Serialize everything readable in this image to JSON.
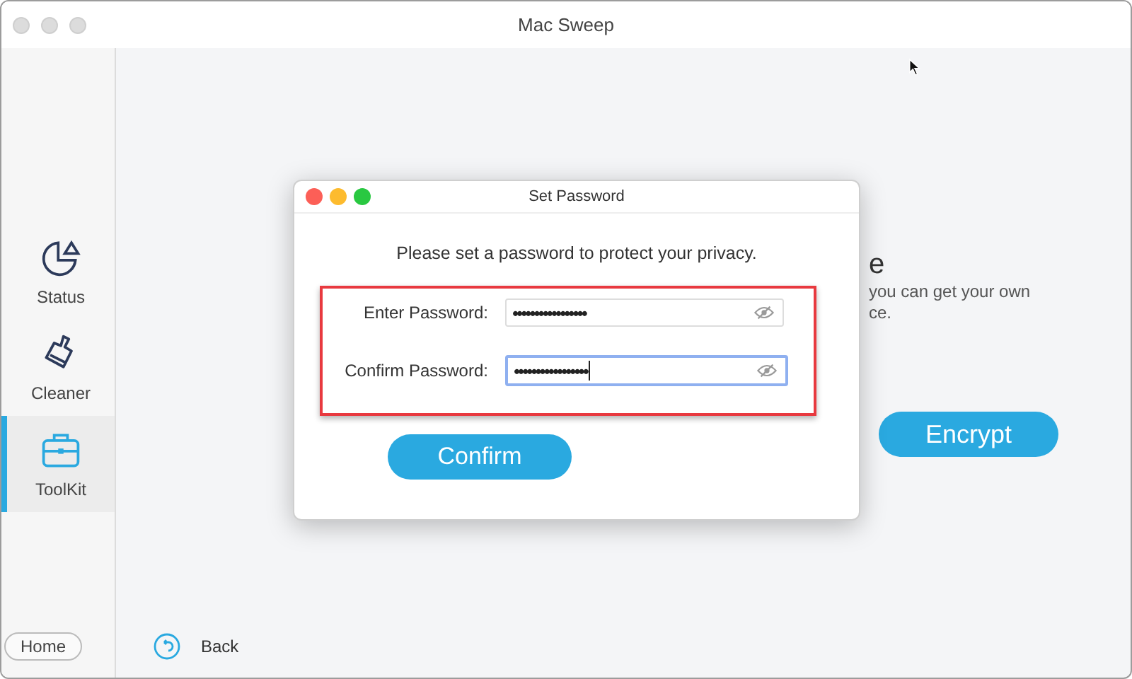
{
  "window": {
    "title": "Mac Sweep"
  },
  "sidebar": {
    "items": [
      {
        "label": "Status",
        "kind": "status",
        "selected": false
      },
      {
        "label": "Cleaner",
        "kind": "cleaner",
        "selected": false
      },
      {
        "label": "ToolKit",
        "kind": "toolkit",
        "selected": true
      }
    ],
    "home_button": "Home"
  },
  "back_link": "Back",
  "background": {
    "heading": "e",
    "description_lines": [
      "you can get your own",
      "ce."
    ],
    "encrypt_button": "Encrypt"
  },
  "dialog": {
    "title": "Set Password",
    "message": "Please set a password to protect your privacy.",
    "fields": [
      {
        "label": "Enter Password:",
        "value": "•••••••••••••••••",
        "focused": false
      },
      {
        "label": "Confirm Password:",
        "value": "•••••••••••••••••",
        "focused": true
      }
    ],
    "confirm_button": "Confirm"
  }
}
